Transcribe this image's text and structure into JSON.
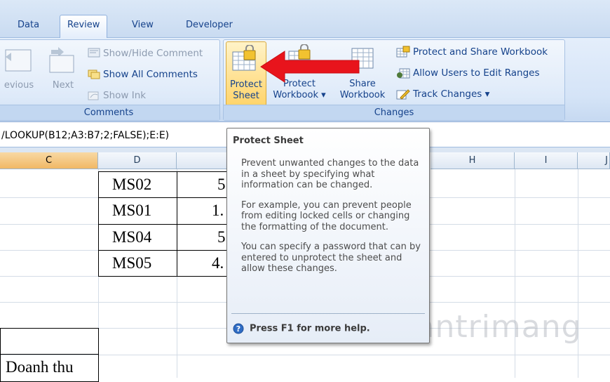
{
  "tabs": [
    {
      "label": "Data"
    },
    {
      "label": "Review"
    },
    {
      "label": "View"
    },
    {
      "label": "Developer"
    }
  ],
  "comments_group": {
    "label": "Comments",
    "previous_label": "evious",
    "next_label": "Next",
    "show_hide_comment": "Show/Hide Comment",
    "show_all_comments": "Show All Comments",
    "show_ink": "Show Ink"
  },
  "changes_group": {
    "label": "Changes",
    "protect_sheet": [
      "Protect",
      "Sheet"
    ],
    "protect_workbook": [
      "Protect",
      "Workbook ▾"
    ],
    "share_workbook": [
      "Share",
      "Workbook"
    ],
    "protect_share_workbook": "Protect and Share Workbook",
    "allow_users": "Allow Users to Edit Ranges",
    "track_changes": "Track Changes ▾"
  },
  "formula_bar": {
    "text": "/LOOKUP(B12;A3:B7;2;FALSE);E:E)"
  },
  "columns": [
    "C",
    "D",
    "H",
    "I",
    "J"
  ],
  "cells": {
    "d_values": [
      "MS02",
      "MS01",
      "MS04",
      "MS05"
    ],
    "e_values": [
      "5",
      "1.",
      "5",
      "4."
    ],
    "c_bottom": "Doanh thu"
  },
  "tooltip": {
    "title": "Protect Sheet",
    "para1": "Prevent unwanted changes to the data in a sheet by specifying what information can be changed.",
    "para2": "For example, you can prevent people from editing locked cells or changing the formatting of the document.",
    "para3": "You can specify a password that can by entered to unprotect the sheet and allow these changes.",
    "help": "Press F1 for more help."
  },
  "watermark": "Quantrimang",
  "colors": {
    "accent": "#15428b",
    "arrow": "#e8141c",
    "selected_col": "#f1b865"
  }
}
